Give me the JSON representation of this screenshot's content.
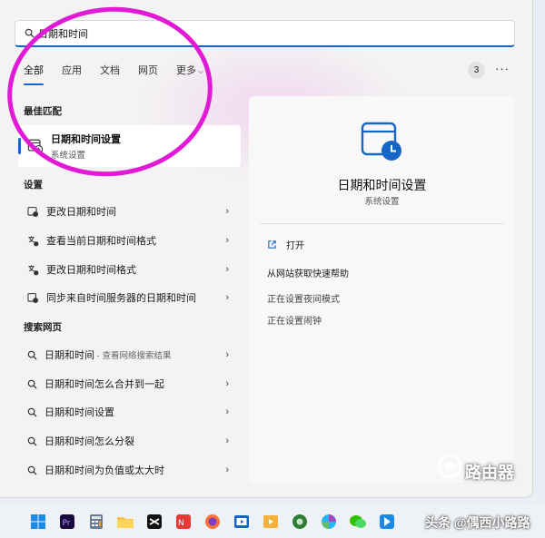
{
  "search": {
    "value": "日期和时间"
  },
  "tabs": [
    {
      "label": "全部"
    },
    {
      "label": "应用"
    },
    {
      "label": "文档"
    },
    {
      "label": "网页"
    },
    {
      "label": "更多"
    }
  ],
  "result_count": "3",
  "best_match": {
    "section": "最佳匹配",
    "title": "日期和时间设置",
    "subtitle": "系统设置"
  },
  "settings": {
    "section": "设置",
    "items": [
      {
        "label": "更改日期和时间"
      },
      {
        "label": "查看当前日期和时间格式"
      },
      {
        "label": "更改日期和时间格式"
      },
      {
        "label": "同步来自时间服务器的日期和时间"
      }
    ]
  },
  "web": {
    "section": "搜索网页",
    "first": {
      "label": "日期和时间",
      "sub": " - 查看网络搜索结果"
    },
    "items": [
      {
        "label": "日期和时间怎么合并到一起"
      },
      {
        "label": "日期和时间设置"
      },
      {
        "label": "日期和时间怎么分裂"
      },
      {
        "label": "日期和时间为负值或太大时"
      }
    ]
  },
  "detail": {
    "title": "日期和时间设置",
    "subtitle": "系统设置",
    "open_label": "打开",
    "actions": [
      {
        "label": "从网站获取快速帮助"
      },
      {
        "label": "正在设置夜间模式"
      },
      {
        "label": "正在设置闹钟"
      }
    ]
  },
  "watermark": {
    "caption": "头条 @偶西小路路",
    "site": "路由器"
  },
  "colors": {
    "accent": "#1666c5",
    "annotation": "#e11ad6"
  }
}
